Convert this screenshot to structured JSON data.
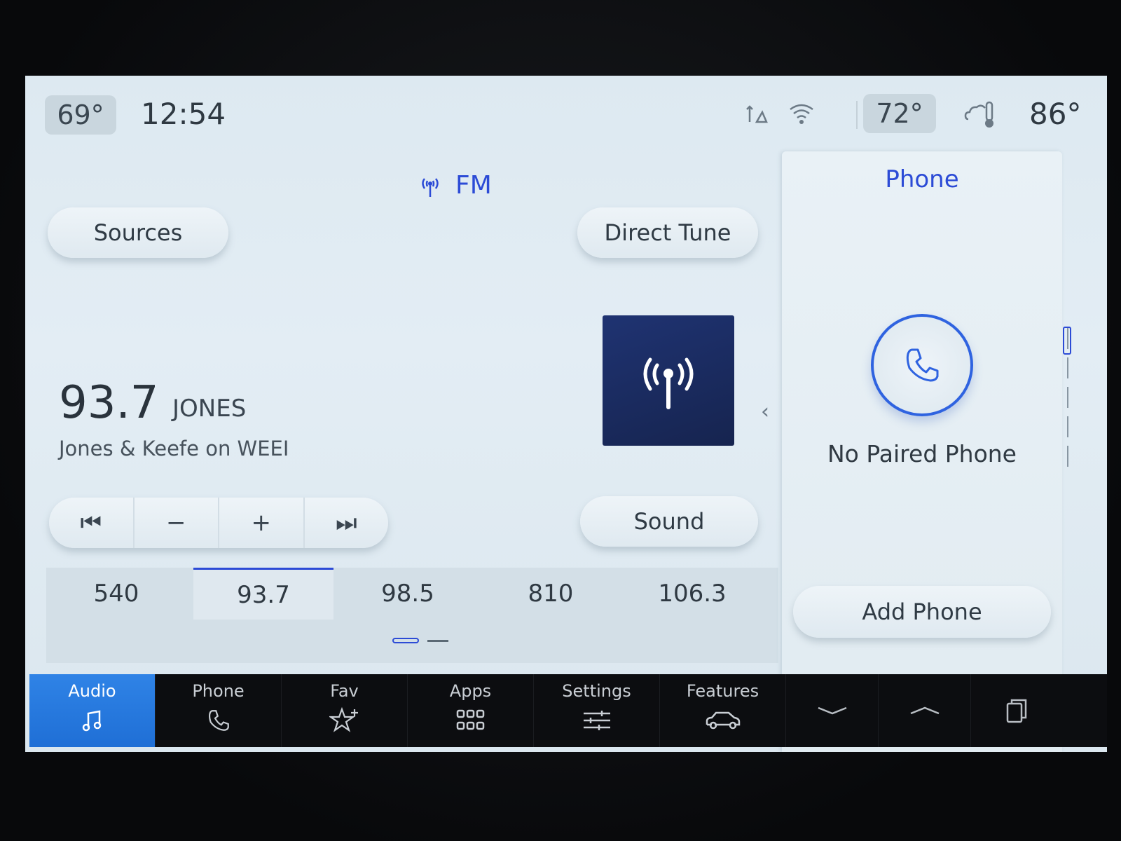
{
  "status": {
    "cabin_temp": "69°",
    "time": "12:54",
    "set_temp": "72°",
    "outside_temp": "86°",
    "icons": [
      "navigation-sync-icon",
      "wifi-icon",
      "weather-thermometer-icon"
    ]
  },
  "audio": {
    "band": "FM",
    "sources_label": "Sources",
    "direct_tune_label": "Direct Tune",
    "sound_label": "Sound",
    "frequency": "93.7",
    "callsign": "JONES",
    "radio_text": "Jones & Keefe on WEEI",
    "transport": [
      "⏮",
      "−",
      "+",
      "⏭"
    ],
    "presets": [
      {
        "label": "540",
        "active": false
      },
      {
        "label": "93.7",
        "active": true
      },
      {
        "label": "98.5",
        "active": false
      },
      {
        "label": "810",
        "active": false
      },
      {
        "label": "106.3",
        "active": false
      }
    ]
  },
  "phone_card": {
    "title": "Phone",
    "status": "No Paired Phone",
    "add_label": "Add Phone"
  },
  "nav": {
    "items": [
      {
        "label": "Audio",
        "icon": "music-note-icon",
        "active": true
      },
      {
        "label": "Phone",
        "icon": "phone-icon",
        "active": false
      },
      {
        "label": "Fav",
        "icon": "star-plus-icon",
        "active": false
      },
      {
        "label": "Apps",
        "icon": "grid-icon",
        "active": false
      },
      {
        "label": "Settings",
        "icon": "sliders-icon",
        "active": false
      },
      {
        "label": "Features",
        "icon": "car-icon",
        "active": false
      }
    ]
  },
  "colors": {
    "accent": "#2c4bd6",
    "nav_active": "#1f6fd6",
    "artwork": "#1f3372"
  }
}
